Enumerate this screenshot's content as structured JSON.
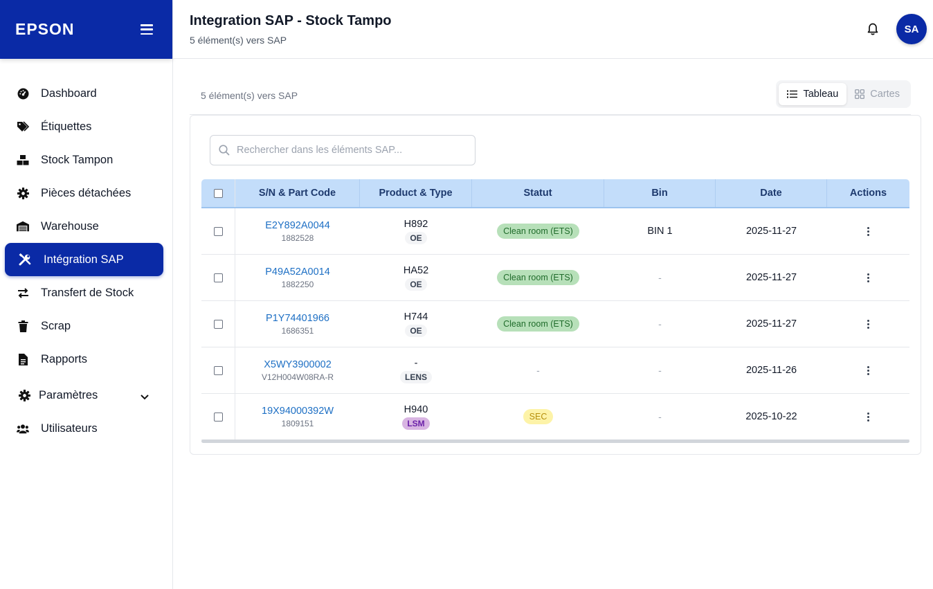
{
  "brand": {
    "logo": "EPSON"
  },
  "sidebar": {
    "items": [
      {
        "label": "Dashboard",
        "icon": "dashboard-gauge-icon"
      },
      {
        "label": "Étiquettes",
        "icon": "tags-icon"
      },
      {
        "label": "Stock Tampon",
        "icon": "boxes-icon"
      },
      {
        "label": "Pièces détachées",
        "icon": "gear-icon"
      },
      {
        "label": "Warehouse",
        "icon": "warehouse-icon"
      },
      {
        "label": "Intégration SAP",
        "icon": "tools-icon",
        "active": true
      },
      {
        "label": "Transfert de Stock",
        "icon": "transfer-arrows-icon"
      },
      {
        "label": "Scrap",
        "icon": "trash-icon"
      },
      {
        "label": "Rapports",
        "icon": "document-icon"
      },
      {
        "label": "Paramètres",
        "icon": "gear-icon"
      },
      {
        "label": "Utilisateurs",
        "icon": "users-icon"
      }
    ]
  },
  "header": {
    "title": "Integration SAP - Stock Tampo",
    "subtitle": "5 élément(s) vers SAP",
    "avatar_initials": "SA"
  },
  "toolbar": {
    "count": "5 élément(s) vers SAP",
    "view_table": "Tableau",
    "view_cards": "Cartes"
  },
  "search": {
    "placeholder": "Rechercher dans les éléments SAP..."
  },
  "table": {
    "columns": [
      "S/N & Part Code",
      "Product & Type",
      "Statut",
      "Bin",
      "Date",
      "Actions"
    ],
    "rows": [
      {
        "sn": "E2Y892A0044",
        "part_code": "1882528",
        "product": "H892",
        "type": "OE",
        "status": "Clean room (ETS)",
        "bin": "BIN 1",
        "date": "2025-11-27"
      },
      {
        "sn": "P49A52A0014",
        "part_code": "1882250",
        "product": "HA52",
        "type": "OE",
        "status": "Clean room (ETS)",
        "bin": "-",
        "date": "2025-11-27"
      },
      {
        "sn": "P1Y74401966",
        "part_code": "1686351",
        "product": "H744",
        "type": "OE",
        "status": "Clean room (ETS)",
        "bin": "-",
        "date": "2025-11-27"
      },
      {
        "sn": "X5WY3900002",
        "part_code": "V12H004W08RA-R",
        "product": "-",
        "type": "LENS",
        "status": "-",
        "bin": "-",
        "date": "2025-11-26"
      },
      {
        "sn": "19X94000392W",
        "part_code": "1809151",
        "product": "H940",
        "type": "LSM",
        "status": "SEC",
        "bin": "-",
        "date": "2025-10-22"
      }
    ]
  },
  "colors": {
    "brand": "#0a2aa6",
    "header_row": "#c3ddfa",
    "link": "#1d6fc4"
  }
}
